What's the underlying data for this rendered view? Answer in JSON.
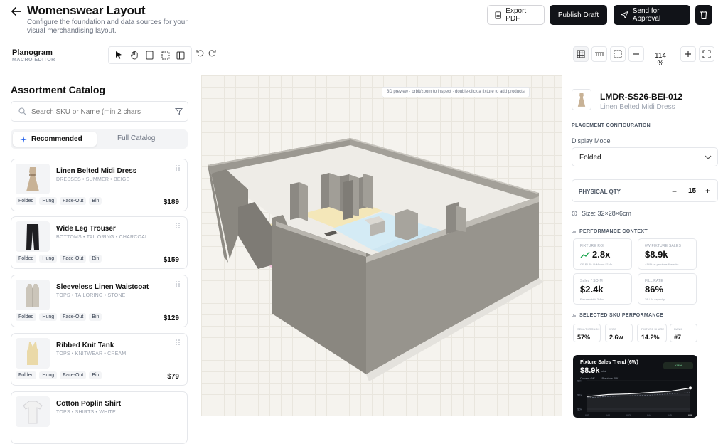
{
  "header": {
    "title": "Womenswear Layout",
    "subtitle": "Configure the foundation and data sources for your visual merchandising layout.",
    "export_label": "Export PDF",
    "publish_label": "Publish Draft",
    "approval_label": "Send for Approval"
  },
  "toolbar": {
    "brand_name": "Planogram",
    "brand_sub": "MACRO EDITOR",
    "zoom": "114 %"
  },
  "catalog": {
    "title": "Assortment Catalog",
    "search_placeholder": "Search SKU or Name (min 2 chars",
    "tab_recommended": "Recommended",
    "tab_full": "Full Catalog",
    "items": [
      {
        "name": "Linen Belted Midi Dress",
        "meta": "DRESSES • SUMMER • BEIGE",
        "price": "$189",
        "tags": [
          "Folded",
          "Hung",
          "Face-Out",
          "Bin"
        ]
      },
      {
        "name": "Wide Leg Trouser",
        "meta": "BOTTOMS • TAILORING • CHARCOAL",
        "price": "$159",
        "tags": [
          "Folded",
          "Hung",
          "Face-Out",
          "Bin"
        ]
      },
      {
        "name": "Sleeveless Linen Waistcoat",
        "meta": "TOPS • TAILORING • STONE",
        "price": "$129",
        "tags": [
          "Folded",
          "Hung",
          "Face-Out",
          "Bin"
        ]
      },
      {
        "name": "Ribbed Knit Tank",
        "meta": "TOPS • KNITWEAR • CREAM",
        "price": "$79",
        "tags": [
          "Folded",
          "Hung",
          "Face-Out",
          "Bin"
        ]
      },
      {
        "name": "Cotton Poplin Shirt",
        "meta": "TOPS • SHIRTS • WHITE",
        "price": "",
        "tags": []
      }
    ]
  },
  "canvas": {
    "hint": "3D preview · orbit/zoom to inspect · double-click a fixture to add products"
  },
  "details": {
    "sku_code": "LMDR-SS26-BEI-012",
    "sku_name": "Linen Belted Midi Dress",
    "placement_title": "PLACEMENT CONFIGURATION",
    "display_mode_label": "Display Mode",
    "display_mode_value": "Folded",
    "qty_label": "PHYSICAL QTY",
    "qty_value": "15",
    "size_text": "Size: 32×28×6cm",
    "perf_title": "PERFORMANCE CONTEXT",
    "metrics": [
      {
        "label": "FIXTURE ROI",
        "value": "2.8x",
        "sub": "GP $1.8k / VM cost $1.4k"
      },
      {
        "label": "6W FIXTURE SALES",
        "value": "$8.9k",
        "sub": "+14% vs previous 6 weeks"
      },
      {
        "label": "Sales / SQ M",
        "value": "$2.4k",
        "sub": "Fixture width 3.4m"
      },
      {
        "label": "FILL RATE",
        "value": "86%",
        "sub": "38 / 44 capacity"
      }
    ],
    "sku_perf_title": "SELECTED SKU PERFORMANCE",
    "sku_metrics": [
      {
        "label": "SELL-THROUGH",
        "value": "57%"
      },
      {
        "label": "WOC",
        "value": "2.6w"
      },
      {
        "label": "FIXTURE SHARE",
        "value": "14.2%"
      },
      {
        "label": "RANK",
        "value": "#7"
      }
    ],
    "trend_title": "Fixture Sales Trend (6W)",
    "trend_value": "$8.9k",
    "trend_total": "total",
    "trend_badge": "+14%",
    "legend_current": "Current 6W",
    "legend_previous": "Previous 6W"
  },
  "colors": {
    "dark": "#111318",
    "wall": "#8d8a83",
    "floor": "#f5f3ee"
  },
  "chart_data": {
    "type": "line",
    "title": "Fixture Sales Trend (6W)",
    "categories": [
      "W1",
      "W2",
      "W3",
      "W4",
      "W5",
      "W6"
    ],
    "series": [
      {
        "name": "Current 6W",
        "values": [
          1.2,
          1.35,
          1.4,
          1.5,
          1.6,
          1.85
        ]
      },
      {
        "name": "Previous 6W",
        "values": [
          1.1,
          1.2,
          1.25,
          1.3,
          1.4,
          1.5
        ]
      }
    ],
    "yticks": [
      "$2k",
      "$1k",
      "$0k"
    ],
    "ylim": [
      0,
      2.2
    ]
  }
}
